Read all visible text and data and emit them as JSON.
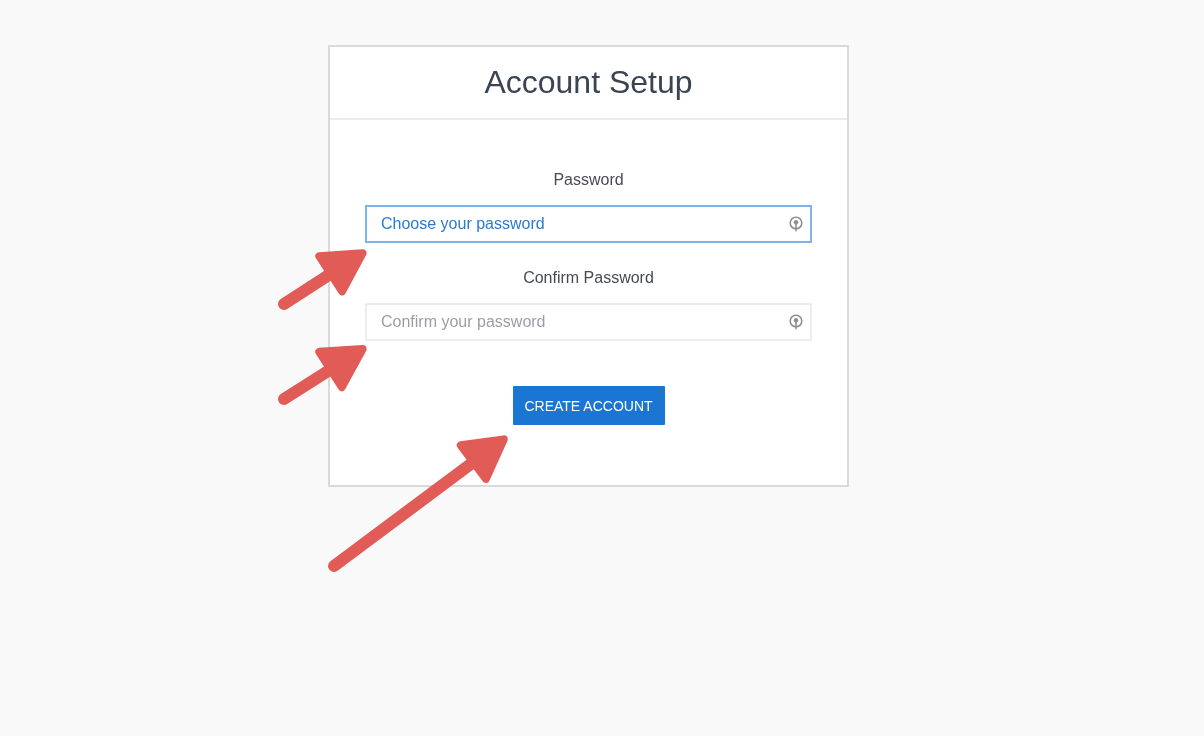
{
  "card": {
    "title": "Account Setup"
  },
  "fields": [
    {
      "label": "Password",
      "placeholder": "Choose your password",
      "focused": true
    },
    {
      "label": "Confirm Password",
      "placeholder": "Confirm your password",
      "focused": false
    }
  ],
  "submit_button": {
    "label": "CREATE ACCOUNT"
  },
  "annotations": [
    {
      "kind": "arrow"
    },
    {
      "kind": "arrow"
    },
    {
      "kind": "arrow"
    }
  ]
}
